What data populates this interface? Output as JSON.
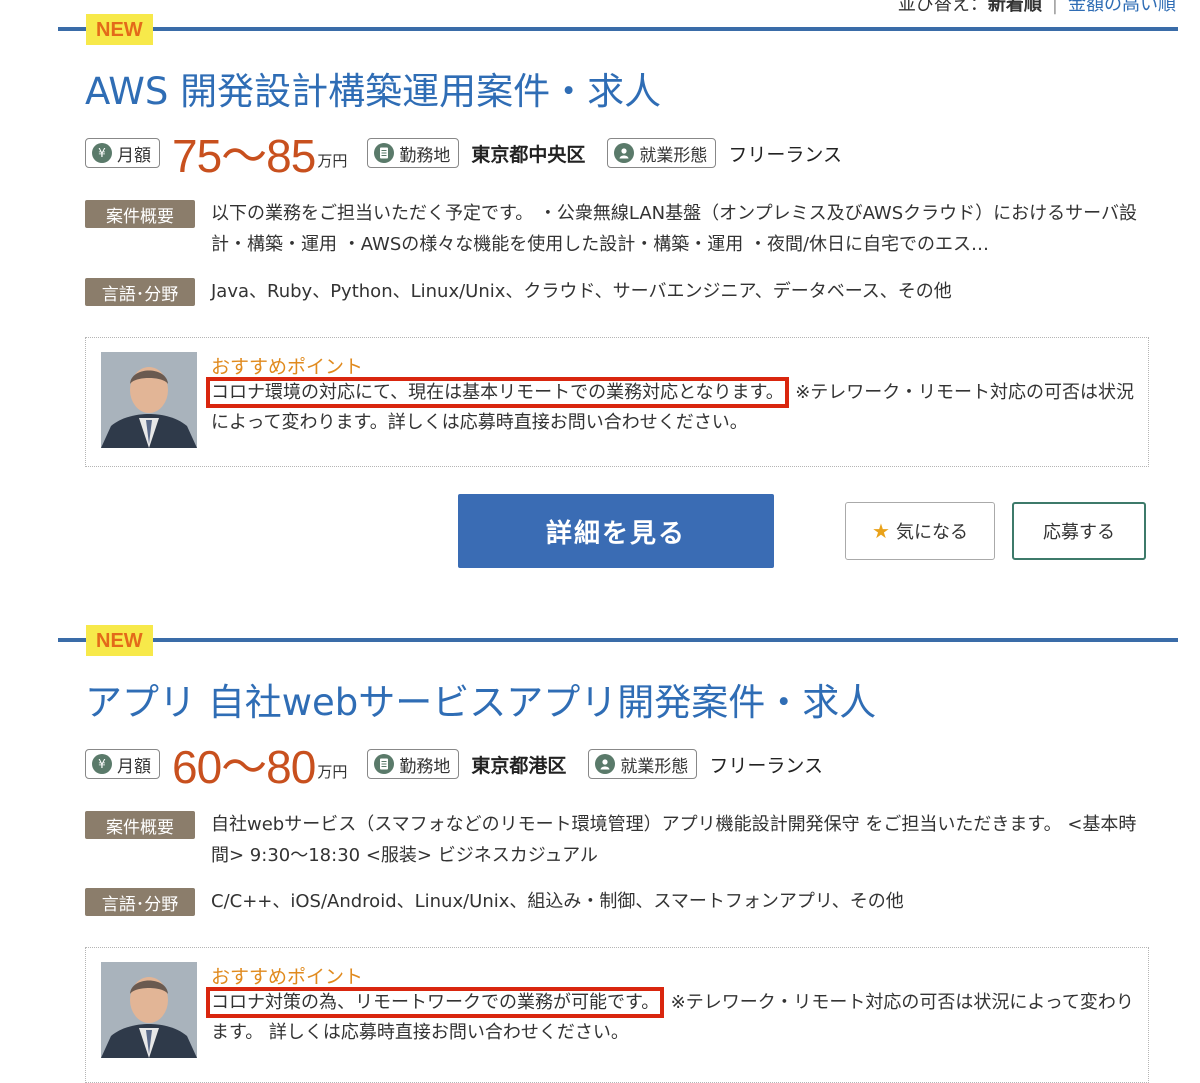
{
  "sort": {
    "label": "並び替え：",
    "active": "新着順",
    "separator": "|",
    "option_high_salary": "金額の高い順"
  },
  "jobs": [
    {
      "badge": "NEW",
      "title": "AWS 開発設計構築運用案件・求人",
      "salary_label": "月額",
      "salary_value": "75〜85",
      "salary_unit": "万円",
      "location_label": "勤務地",
      "location": "東京都中央区",
      "employment_label": "就業形態",
      "employment": "フリーランス",
      "summary_label": "案件概要",
      "summary": "以下の業務をご担当いただく予定です。 ・公衆無線LAN基盤（オンプレミス及びAWSクラウド）におけるサーバ設計・構築・運用 ・AWSの様々な機能を使用した設計・構築・運用 ・夜間/休日に自宅でのエス…",
      "skills_label": "言語･分野",
      "skills": "Java、Ruby、Python、Linux/Unix、クラウド、サーバエンジニア、データベース、その他",
      "rec_title": "おすすめポイント",
      "rec_highlight": "コロナ環境の対応にて、現在は基本リモートでの業務対応となります。",
      "rec_rest": "※テレワーク・リモート対応の可否は状況によって変わります。詳しくは応募時直接お問い合わせください。",
      "detail_button": "詳細を見る",
      "fav_button": "気になる",
      "apply_button": "応募する"
    },
    {
      "badge": "NEW",
      "title": "アプリ 自社webサービスアプリ開発案件・求人",
      "salary_label": "月額",
      "salary_value": "60〜80",
      "salary_unit": "万円",
      "location_label": "勤務地",
      "location": "東京都港区",
      "employment_label": "就業形態",
      "employment": "フリーランス",
      "summary_label": "案件概要",
      "summary": "自社webサービス（スマフォなどのリモート環境管理）アプリ機能設計開発保守 をご担当いただきます。 <基本時間> 9:30〜18:30 <服装> ビジネスカジュアル",
      "skills_label": "言語･分野",
      "skills": "C/C++、iOS/Android、Linux/Unix、組込み・制御、スマートフォンアプリ、その他",
      "rec_title": "おすすめポイント",
      "rec_highlight": "コロナ対策の為、リモートワークでの業務が可能です。",
      "rec_rest": "※テレワーク・リモート対応の可否は状況によって変わります。 詳しくは応募時直接お問い合わせください。"
    }
  ],
  "icons": {
    "yen": "¥",
    "location": "document-icon",
    "employment": "person-icon",
    "star": "★"
  },
  "colors": {
    "accent_blue": "#2f6db5",
    "salary_orange": "#c8501e",
    "highlight_red": "#d9260e",
    "badge_yellow": "#f7e94a"
  }
}
